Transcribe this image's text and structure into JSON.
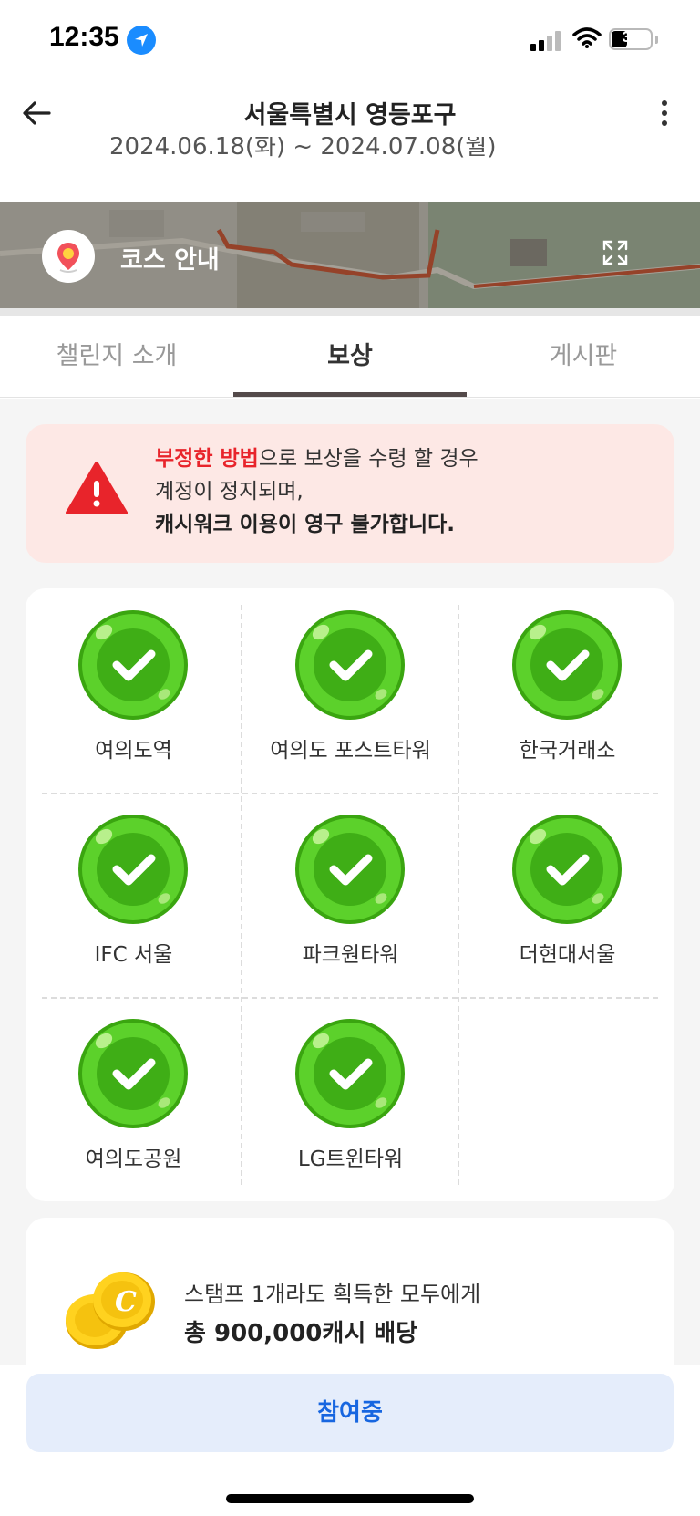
{
  "status_bar": {
    "time": "12:35",
    "battery": "31",
    "icons": [
      "location-arrow-icon",
      "signal-icon",
      "wifi-icon",
      "battery-icon"
    ]
  },
  "header": {
    "title": "서울특별시 영등포구",
    "date_range": "2024.06.18(화) ~ 2024.07.08(월)",
    "back_icon": "arrow-left-icon",
    "more_icon": "more-vertical-icon"
  },
  "map_banner": {
    "label": "코스 안내",
    "icons": [
      "map-pin-icon",
      "expand-icon"
    ]
  },
  "tabs": [
    {
      "label": "챌린지 소개",
      "active": false
    },
    {
      "label": "보상",
      "active": true
    },
    {
      "label": "게시판",
      "active": false
    }
  ],
  "warning": {
    "line1_highlight": "부정한 방법",
    "line1_rest": "으로 보상을 수령 할 경우",
    "line2": "계정이 정지되며,",
    "line3": "캐시워크 이용이 영구 불가합니다.",
    "icon": "warning-triangle-icon",
    "highlight_color": "#e8242b"
  },
  "stamps": [
    {
      "label": "여의도역",
      "collected": true
    },
    {
      "label": "여의도 포스트타워",
      "collected": true
    },
    {
      "label": "한국거래소",
      "collected": true
    },
    {
      "label": "IFC 서울",
      "collected": true
    },
    {
      "label": "파크원타워",
      "collected": true
    },
    {
      "label": "더현대서울",
      "collected": true
    },
    {
      "label": "여의도공원",
      "collected": true
    },
    {
      "label": "LG트윈타워",
      "collected": true
    }
  ],
  "reward": {
    "line1": "스탬프 1개라도 획득한 모두에게",
    "line2": "총 900,000캐시 배당",
    "icon": "gold-coins-icon"
  },
  "bottom": {
    "button_label": "참여중",
    "button_color": "#1766e0"
  },
  "colors": {
    "stamp_green": "#4cc21c",
    "warning_bg": "#fde8e5",
    "warning_red": "#e8242b"
  }
}
